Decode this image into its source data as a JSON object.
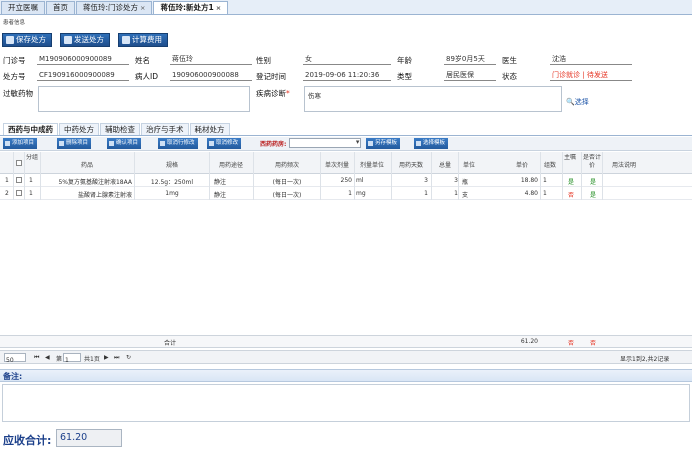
{
  "tabs": [
    {
      "label": "开立医嘱",
      "closable": false,
      "active": false
    },
    {
      "label": "首页",
      "closable": false,
      "active": false
    },
    {
      "label": "蒋伍玲:门诊处方",
      "closable": true,
      "active": false
    },
    {
      "label": "蒋伍玲:新处方1",
      "closable": true,
      "active": true
    }
  ],
  "tab_close_glyph": "×",
  "section_title": "患者信息",
  "actions": {
    "save": "保存处方",
    "send": "发送处方",
    "calc": "计算费用"
  },
  "patient": {
    "clinic_no_label": "门诊号",
    "clinic_no": "M190906000900089",
    "name_label": "姓名",
    "name": "蒋伍玲",
    "gender_label": "性别",
    "gender": "女",
    "age_label": "年龄",
    "age": "89岁0月5天",
    "doctor_label": "医生",
    "doctor": "沈浩",
    "rx_no_label": "处方号",
    "rx_no": "CF190916000900089",
    "patient_id_label": "病人ID",
    "patient_id": "190906000900088",
    "reg_time_label": "登记时间",
    "reg_time": "2019-09-06 11:20:36",
    "type_label": "类型",
    "type": "居民医保",
    "status_label": "状态",
    "status_a": "门诊就诊",
    "status_sep": "|",
    "status_b": "待发送",
    "allergy_label": "过敏药物",
    "diagnosis_label": "疾病诊断",
    "required_mark": "*",
    "diagnosis": "伤寒",
    "choose_link": "选择"
  },
  "subtabs": [
    "西药与中成药",
    "中药处方",
    "辅助检查",
    "治疗与手术",
    "耗材处方"
  ],
  "grid_toolbar": {
    "add": "添加项目",
    "delete": "删除项目",
    "confirm": "确认项目",
    "cancel_row": "取消行修改",
    "cancel_all": "取消修改",
    "pharmacy_label": "西药药房:",
    "save_tpl": "另存模板",
    "select_tpl": "选择模板"
  },
  "columns": [
    "分组",
    "药品",
    "规格",
    "用药途径",
    "用药频次",
    "单次剂量",
    "剂量单位",
    "用药天数",
    "总量",
    "单位",
    "单价",
    "组数",
    "主嘱",
    "是否计价",
    "用法说明"
  ],
  "rows": [
    {
      "no": "1",
      "group": "1",
      "drug": "5%复方氨基酸注射液18AA",
      "spec": "12.5g：250ml",
      "route": "静注",
      "freq": "(每日一次)",
      "dose": "250",
      "dose_unit": "ml",
      "days": "3",
      "total": "3",
      "unit": "瓶",
      "price": "18.80",
      "groups": "1",
      "main": "是",
      "priced": "是"
    },
    {
      "no": "2",
      "group": "1",
      "drug": "盐酸肾上腺素注射液",
      "spec": "1mg",
      "route": "静注",
      "freq": "(每日一次)",
      "dose": "1",
      "dose_unit": "mg",
      "days": "1",
      "total": "1",
      "unit": "支",
      "price": "4.80",
      "groups": "1",
      "main": "否",
      "priced": "是"
    }
  ],
  "totals": {
    "label": "合计",
    "price": "61.20",
    "main": "否",
    "priced": "否"
  },
  "pager": {
    "page_size": "50",
    "page_prefix": "第",
    "page": "1",
    "page_suffix": "共1页",
    "summary": "显示1到2,共2记录"
  },
  "remarks_label": "备注:",
  "sum_label": "应收合计:",
  "sum_value": "61.20",
  "colors": {
    "primary": "#2a62a8",
    "status_red": "#e53322",
    "yes_green": "#1a8a1a",
    "accent_navy": "#1b3f8a"
  }
}
